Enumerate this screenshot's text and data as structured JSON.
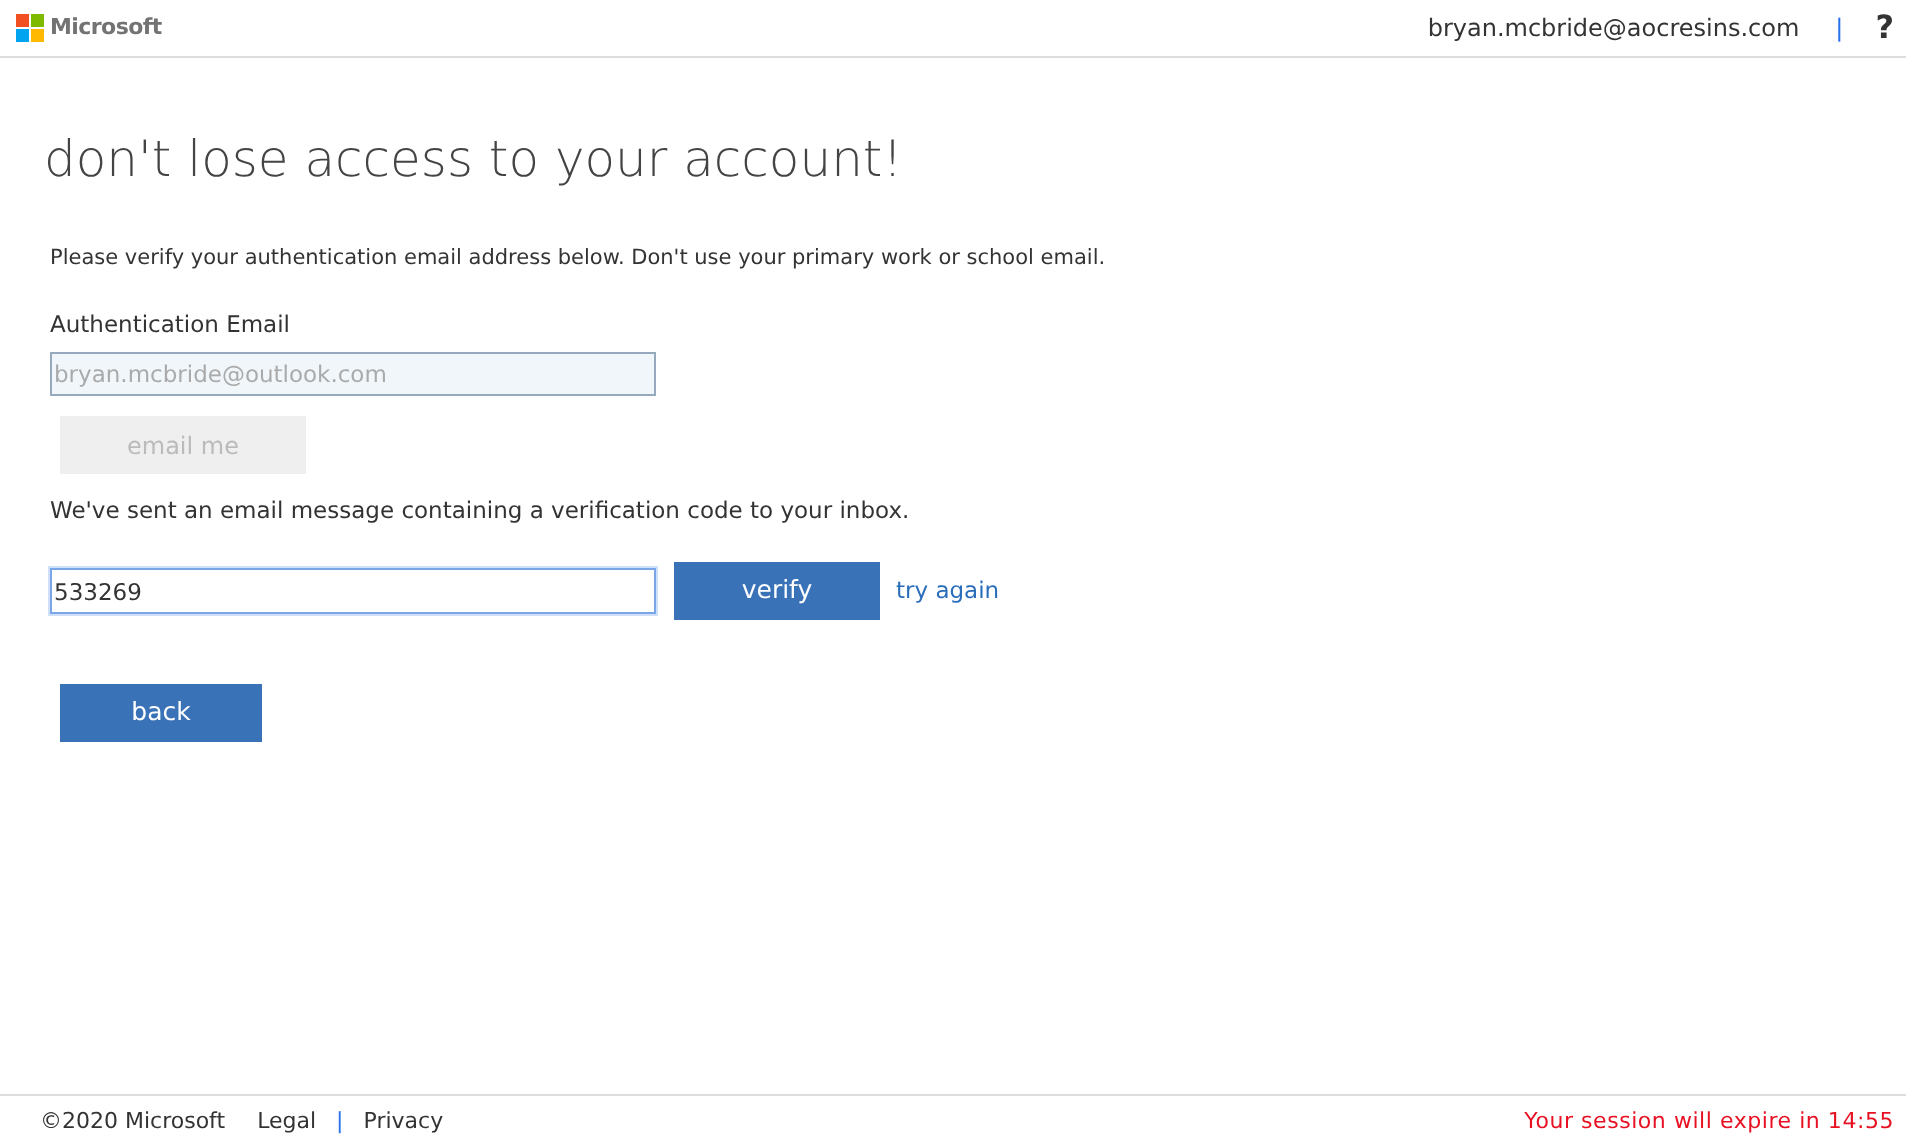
{
  "header": {
    "brand": "Microsoft",
    "user": "bryan.mcbride@aocresins.com",
    "separator": "|",
    "help": "?"
  },
  "title": "don't lose access to your account!",
  "intro": "Please verify your authentication email address below. Don't use your primary work or school email.",
  "email_field": {
    "label": "Authentication Email",
    "value": "bryan.mcbride@outlook.com",
    "disabled": true
  },
  "email_button": {
    "label": "email me",
    "disabled": true
  },
  "sent_message": "We've sent an email message containing a verification code to your inbox.",
  "code_field": {
    "value": "533269",
    "focused": true
  },
  "verify_button": "verify",
  "try_again_link": "try again",
  "back_button": "back",
  "footer": {
    "copyright": "©2020 Microsoft",
    "links": [
      "Legal",
      "Privacy"
    ],
    "separator": "|",
    "session": "Your session will expire in 14:55"
  }
}
